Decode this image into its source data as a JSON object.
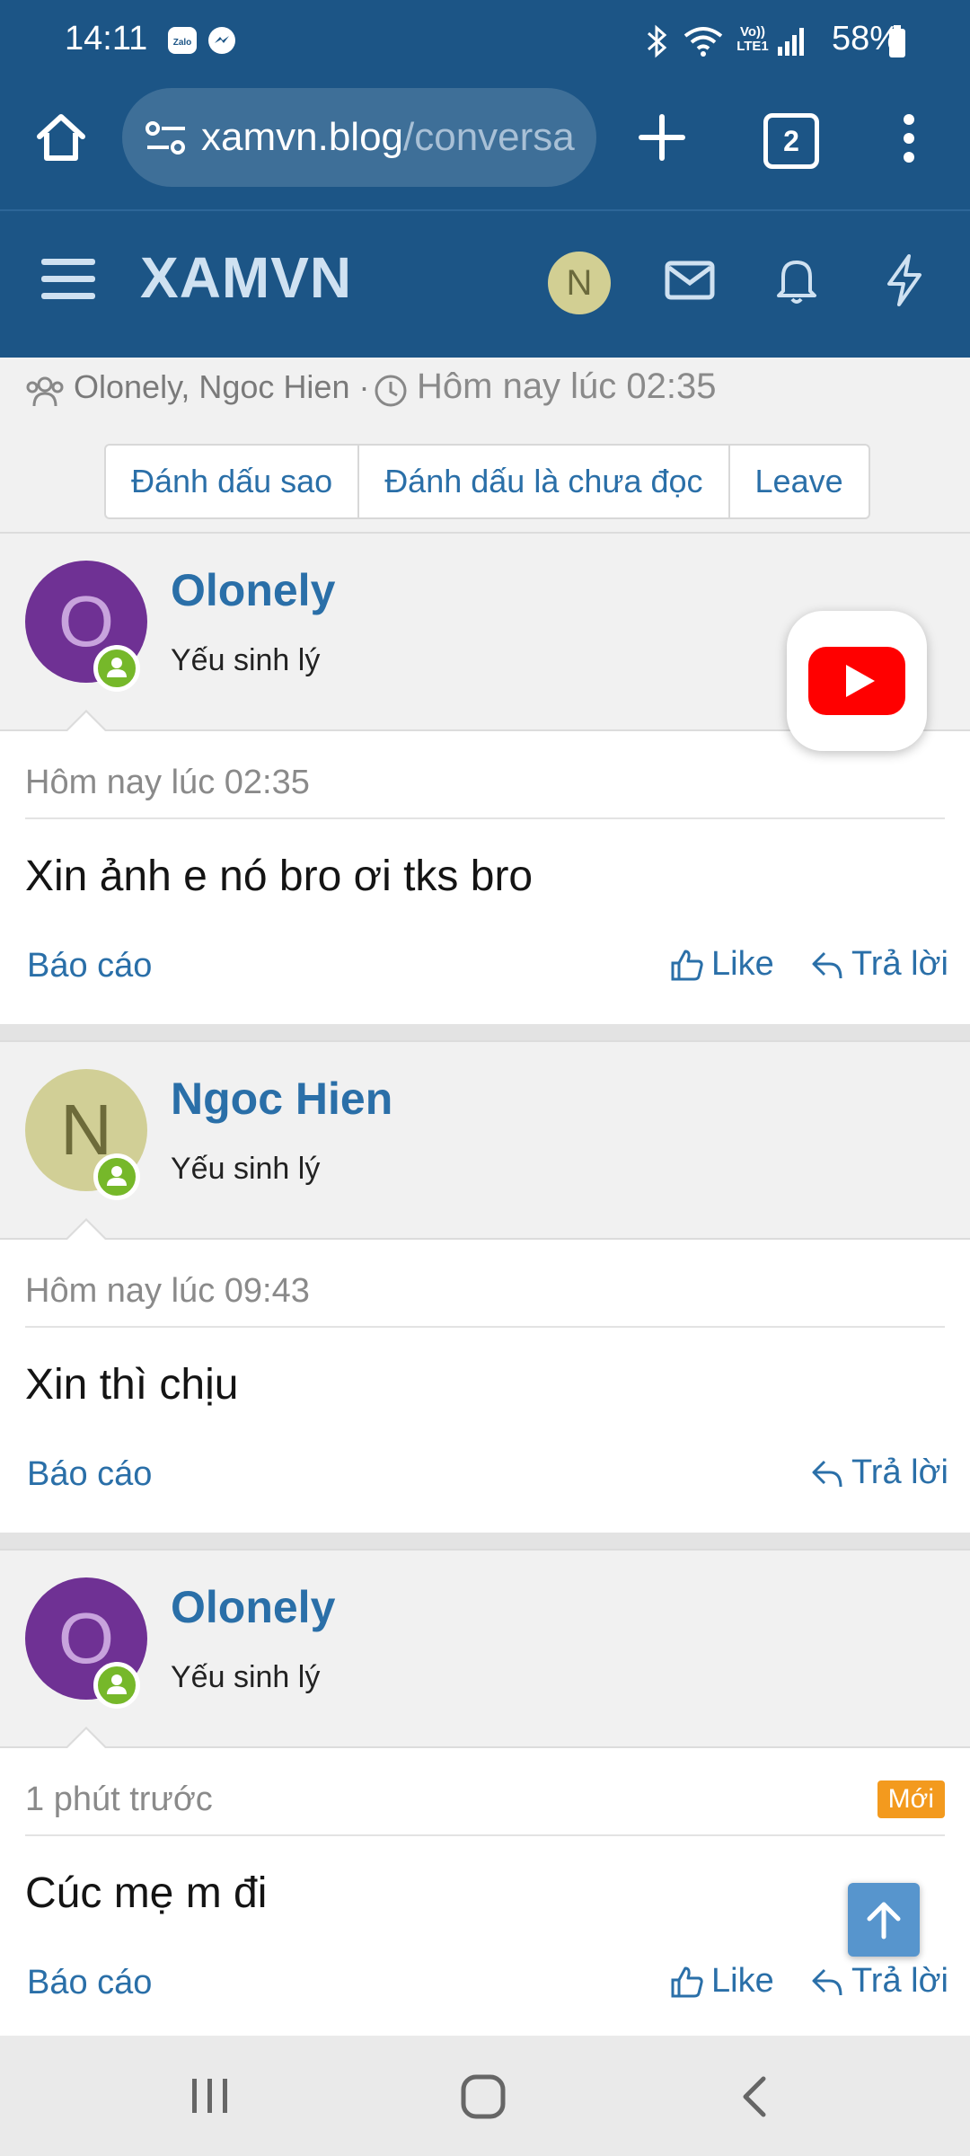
{
  "status": {
    "time": "14:11",
    "notif_icons": [
      "zalo-icon",
      "messenger-icon"
    ],
    "battery": "58%",
    "right_icons": [
      "bluetooth-icon",
      "wifi-icon",
      "volte-icon",
      "signal-icon",
      "battery-icon"
    ],
    "volte_label": "Vo)) LTE1",
    "zalo_label": "Zalo"
  },
  "browser": {
    "url_host": "xamvn.blog",
    "url_path": "/conversa",
    "tab_count": "2"
  },
  "site": {
    "brand": "XAMVN",
    "avatar_letter": "N"
  },
  "conversation": {
    "participants": "Olonely, Ngoc Hien ·",
    "started": "Hôm nay lúc 02:35",
    "actions": [
      "Đánh dấu sao",
      "Đánh dấu là chưa đọc",
      "Leave"
    ]
  },
  "messages": [
    {
      "author": "Olonely",
      "initial": "O",
      "title": "Yếu sinh lý",
      "time": "Hôm nay lúc 02:35",
      "text": "Xin ảnh e nó bro ơi tks bro",
      "report": "Báo cáo",
      "like": "Like",
      "reply": "Trả lời"
    },
    {
      "author": "Ngoc Hien",
      "initial": "N",
      "title": "Yếu sinh lý",
      "time": "Hôm nay lúc 09:43",
      "text": "Xin thì chịu",
      "report": "Báo cáo",
      "reply": "Trả lời"
    },
    {
      "author": "Olonely",
      "initial": "O",
      "title": "Yếu sinh lý",
      "time": "1 phút trước",
      "badge": "Mới",
      "text": "Cúc mẹ m đi",
      "report": "Báo cáo",
      "like": "Like",
      "reply": "Trả lời"
    }
  ],
  "colors": {
    "header_blue": "#1c5586",
    "link_blue": "#2a6fa8",
    "online_green": "#76b82a",
    "badge_orange": "#f39a1e",
    "youtube_red": "#ff0000"
  }
}
